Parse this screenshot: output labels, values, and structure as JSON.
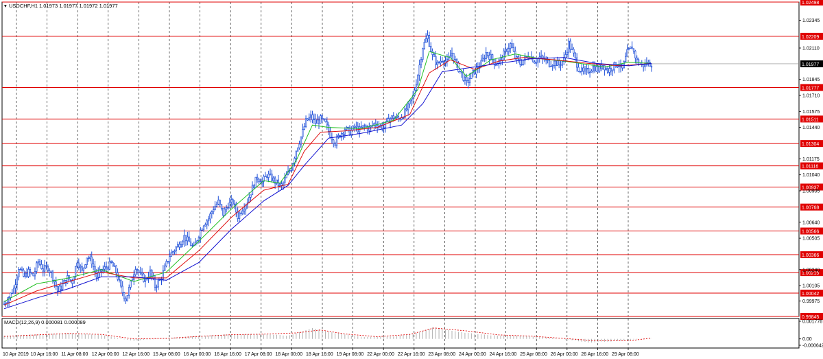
{
  "header": {
    "symbol": "USDCHF,H1",
    "ohlc": "1.01973 1.01977 1.01972 1.01977"
  },
  "macd_header": "MACD(12,26,9) 0.000081 0.000089",
  "colors": {
    "candles": "#1e4fd8",
    "ma_fast": "#22c022",
    "ma_mid": "#e01010",
    "ma_slow": "#1010d0",
    "levels": "#e00000",
    "grid": "#000000",
    "macd_hist": "#b0b0b0",
    "macd_signal": "#e00000",
    "current_price_tag": "#000000"
  },
  "chart_data": {
    "type": "line",
    "title": "USDCHF,H1",
    "ylim": [
      0.99845,
      1.02498
    ],
    "price_ticks": [
      "1.02345",
      "1.02110",
      "1.01845",
      "1.01710",
      "1.01575",
      "1.01440",
      "1.01175",
      "1.01040",
      "1.00905",
      "1.00640",
      "1.00505",
      "1.00240",
      "1.00105",
      "0.99975"
    ],
    "levels": [
      "1.02498",
      "1.02209",
      "1.01777",
      "1.01511",
      "1.01304",
      "1.01116",
      "1.00937",
      "1.00768",
      "1.00566",
      "1.00366",
      "1.00215",
      "1.00042",
      "0.99845"
    ],
    "current_price": "1.01977",
    "x_labels": [
      "10 Apr 2019",
      "10 Apr 16:00",
      "11 Apr 08:00",
      "12 Apr 00:00",
      "12 Apr 16:00",
      "15 Apr 08:00",
      "16 Apr 00:00",
      "16 Apr 16:00",
      "17 Apr 08:00",
      "18 Apr 00:00",
      "18 Apr 16:00",
      "19 Apr 08:00",
      "22 Apr 00:00",
      "22 Apr 16:00",
      "23 Apr 08:00",
      "24 Apr 00:00",
      "24 Apr 16:00",
      "25 Apr 08:00",
      "26 Apr 00:00",
      "26 Apr 16:00",
      "29 Apr 08:00"
    ],
    "close_path": [
      [
        0,
        0.9995
      ],
      [
        3,
        1.0001
      ],
      [
        6,
        1.0008
      ],
      [
        9,
        1.0026
      ],
      [
        12,
        1.0018
      ],
      [
        15,
        1.0022
      ],
      [
        18,
        1.0019
      ],
      [
        21,
        1.0031
      ],
      [
        24,
        1.0024
      ],
      [
        27,
        1.0026
      ],
      [
        30,
        1.0018
      ],
      [
        33,
        1.0006
      ],
      [
        36,
        1.0011
      ],
      [
        39,
        1.0017
      ],
      [
        42,
        1.0014
      ],
      [
        45,
        1.0032
      ],
      [
        48,
        1.0022
      ],
      [
        51,
        1.0035
      ],
      [
        54,
        1.0031
      ],
      [
        57,
        1.0018
      ],
      [
        60,
        1.0023
      ],
      [
        63,
        1.0026
      ],
      [
        66,
        1.0029
      ],
      [
        69,
        1.0022
      ],
      [
        72,
        1.0008
      ],
      [
        75,
        0.9999
      ],
      [
        78,
        1.0012
      ],
      [
        81,
        1.0027
      ],
      [
        84,
        1.0019
      ],
      [
        87,
        1.0015
      ],
      [
        90,
        1.0022
      ],
      [
        93,
        1.001
      ],
      [
        96,
        1.0015
      ],
      [
        99,
        1.0025
      ],
      [
        102,
        1.0036
      ],
      [
        105,
        1.0041
      ],
      [
        108,
        1.0046
      ],
      [
        111,
        1.0052
      ],
      [
        114,
        1.0047
      ],
      [
        117,
        1.0042
      ],
      [
        120,
        1.0054
      ],
      [
        123,
        1.0063
      ],
      [
        126,
        1.0067
      ],
      [
        129,
        1.0076
      ],
      [
        132,
        1.0081
      ],
      [
        135,
        1.0071
      ],
      [
        138,
        1.0079
      ],
      [
        141,
        1.0081
      ],
      [
        144,
        1.0069
      ],
      [
        147,
        1.0076
      ],
      [
        150,
        1.0082
      ],
      [
        153,
        1.0093
      ],
      [
        156,
        1.0102
      ],
      [
        159,
        1.0098
      ],
      [
        162,
        1.0104
      ],
      [
        165,
        1.0101
      ],
      [
        168,
        1.0097
      ],
      [
        171,
        1.0094
      ],
      [
        174,
        1.0103
      ],
      [
        177,
        1.011
      ],
      [
        180,
        1.0125
      ],
      [
        183,
        1.0136
      ],
      [
        186,
        1.0149
      ],
      [
        189,
        1.0153
      ],
      [
        192,
        1.0148
      ],
      [
        195,
        1.0151
      ],
      [
        198,
        1.0147
      ],
      [
        201,
        1.0138
      ],
      [
        204,
        1.0131
      ],
      [
        207,
        1.0138
      ],
      [
        210,
        1.0143
      ],
      [
        213,
        1.014
      ],
      [
        216,
        1.0144
      ],
      [
        219,
        1.0142
      ],
      [
        222,
        1.0145
      ],
      [
        225,
        1.0143
      ],
      [
        228,
        1.0147
      ],
      [
        231,
        1.0146
      ],
      [
        234,
        1.0144
      ],
      [
        237,
        1.0151
      ],
      [
        240,
        1.0153
      ],
      [
        243,
        1.0151
      ],
      [
        246,
        1.0155
      ],
      [
        249,
        1.0161
      ],
      [
        252,
        1.017
      ],
      [
        255,
        1.0189
      ],
      [
        258,
        1.0212
      ],
      [
        261,
        1.0221
      ],
      [
        264,
        1.0204
      ],
      [
        267,
        1.0197
      ],
      [
        270,
        1.0202
      ],
      [
        273,
        1.0199
      ],
      [
        276,
        1.0207
      ],
      [
        279,
        1.0196
      ],
      [
        282,
        1.0189
      ],
      [
        285,
        1.0181
      ],
      [
        288,
        1.0188
      ],
      [
        291,
        1.0193
      ],
      [
        294,
        1.0198
      ],
      [
        297,
        1.0207
      ],
      [
        300,
        1.0203
      ],
      [
        303,
        1.0198
      ],
      [
        306,
        1.0201
      ],
      [
        309,
        1.0208
      ],
      [
        312,
        1.0214
      ],
      [
        315,
        1.0203
      ],
      [
        318,
        1.0198
      ],
      [
        321,
        1.0202
      ],
      [
        324,
        1.0205
      ],
      [
        327,
        1.02
      ],
      [
        330,
        1.0203
      ],
      [
        333,
        1.0201
      ],
      [
        336,
        1.0198
      ],
      [
        339,
        1.0199
      ],
      [
        342,
        1.0197
      ],
      [
        345,
        1.0201
      ],
      [
        348,
        1.0215
      ],
      [
        351,
        1.0205
      ],
      [
        354,
        1.0194
      ],
      [
        357,
        1.019
      ],
      [
        360,
        1.0192
      ],
      [
        363,
        1.0195
      ],
      [
        366,
        1.0193
      ],
      [
        369,
        1.0197
      ],
      [
        372,
        1.0192
      ],
      [
        375,
        1.0195
      ],
      [
        378,
        1.0198
      ],
      [
        381,
        1.0193
      ],
      [
        384,
        1.0207
      ],
      [
        387,
        1.0212
      ],
      [
        390,
        1.02
      ],
      [
        393,
        1.0196
      ],
      [
        396,
        1.0198
      ],
      [
        399,
        1.01977
      ]
    ],
    "ma_fast_path": [
      [
        0,
        0.9997
      ],
      [
        20,
        1.0012
      ],
      [
        40,
        1.0017
      ],
      [
        60,
        1.0024
      ],
      [
        80,
        1.0014
      ],
      [
        100,
        1.0022
      ],
      [
        120,
        1.0048
      ],
      [
        140,
        1.0075
      ],
      [
        160,
        1.0099
      ],
      [
        170,
        1.0097
      ],
      [
        180,
        1.0116
      ],
      [
        190,
        1.0146
      ],
      [
        200,
        1.0144
      ],
      [
        220,
        1.0143
      ],
      [
        240,
        1.015
      ],
      [
        255,
        1.0176
      ],
      [
        262,
        1.0208
      ],
      [
        275,
        1.0203
      ],
      [
        285,
        1.0187
      ],
      [
        300,
        1.0201
      ],
      [
        315,
        1.0206
      ],
      [
        330,
        1.0202
      ],
      [
        345,
        1.02
      ],
      [
        355,
        1.0198
      ],
      [
        370,
        1.0195
      ],
      [
        385,
        1.0199
      ],
      [
        399,
        1.0198
      ]
    ],
    "ma_mid_path": [
      [
        0,
        0.9994
      ],
      [
        20,
        1.0006
      ],
      [
        40,
        1.0014
      ],
      [
        60,
        1.0022
      ],
      [
        80,
        1.0017
      ],
      [
        100,
        1.0017
      ],
      [
        120,
        1.004
      ],
      [
        140,
        1.0068
      ],
      [
        160,
        1.0091
      ],
      [
        175,
        1.0096
      ],
      [
        185,
        1.0124
      ],
      [
        195,
        1.014
      ],
      [
        210,
        1.0141
      ],
      [
        230,
        1.0144
      ],
      [
        250,
        1.0155
      ],
      [
        262,
        1.019
      ],
      [
        275,
        1.0201
      ],
      [
        290,
        1.0193
      ],
      [
        305,
        1.02
      ],
      [
        320,
        1.0203
      ],
      [
        340,
        1.0201
      ],
      [
        360,
        1.0198
      ],
      [
        380,
        1.0196
      ],
      [
        399,
        1.0198
      ]
    ],
    "ma_slow_path": [
      [
        0,
        0.9991
      ],
      [
        20,
        1.0
      ],
      [
        40,
        1.0008
      ],
      [
        60,
        1.0018
      ],
      [
        80,
        1.0018
      ],
      [
        100,
        1.0015
      ],
      [
        120,
        1.003
      ],
      [
        140,
        1.0058
      ],
      [
        160,
        1.0082
      ],
      [
        175,
        1.0095
      ],
      [
        185,
        1.0112
      ],
      [
        200,
        1.0135
      ],
      [
        220,
        1.0139
      ],
      [
        245,
        1.0146
      ],
      [
        258,
        1.0164
      ],
      [
        270,
        1.0191
      ],
      [
        285,
        1.0194
      ],
      [
        305,
        1.0198
      ],
      [
        325,
        1.0202
      ],
      [
        345,
        1.0203
      ],
      [
        365,
        1.0198
      ],
      [
        385,
        1.0196
      ],
      [
        399,
        1.0198
      ]
    ],
    "macd": {
      "ylim": [
        -0.000642,
        0.001778
      ],
      "ticks": [
        "0.001778",
        "0.00",
        "-0.000642"
      ],
      "hist": [
        [
          0,
          0.0003
        ],
        [
          20,
          0.00045
        ],
        [
          40,
          0.0006
        ],
        [
          60,
          0.0004
        ],
        [
          80,
          -0.0002
        ],
        [
          100,
          0.0001
        ],
        [
          120,
          0.0003
        ],
        [
          140,
          0.00045
        ],
        [
          160,
          0.0005
        ],
        [
          175,
          0.0003
        ],
        [
          190,
          0.0011
        ],
        [
          200,
          0.0007
        ],
        [
          220,
          0.0002
        ],
        [
          240,
          0.00025
        ],
        [
          255,
          0.0006
        ],
        [
          265,
          0.0012
        ],
        [
          280,
          0.0007
        ],
        [
          300,
          0.00035
        ],
        [
          320,
          0.0003
        ],
        [
          340,
          0.0001
        ],
        [
          360,
          -0.00035
        ],
        [
          380,
          -0.0002
        ],
        [
          399,
          8e-05
        ]
      ],
      "signal": [
        [
          0,
          0.00025
        ],
        [
          20,
          0.0004
        ],
        [
          40,
          0.00055
        ],
        [
          60,
          0.00045
        ],
        [
          80,
          0.0
        ],
        [
          100,
          5e-05
        ],
        [
          120,
          0.00025
        ],
        [
          140,
          0.00042
        ],
        [
          160,
          0.00048
        ],
        [
          180,
          0.0006
        ],
        [
          195,
          0.0009
        ],
        [
          210,
          0.0005
        ],
        [
          230,
          0.00022
        ],
        [
          250,
          0.00045
        ],
        [
          265,
          0.0011
        ],
        [
          285,
          0.0008
        ],
        [
          305,
          0.0004
        ],
        [
          325,
          0.00028
        ],
        [
          345,
          5e-05
        ],
        [
          365,
          -0.0002
        ],
        [
          385,
          -0.0002
        ],
        [
          399,
          9e-05
        ]
      ]
    }
  }
}
